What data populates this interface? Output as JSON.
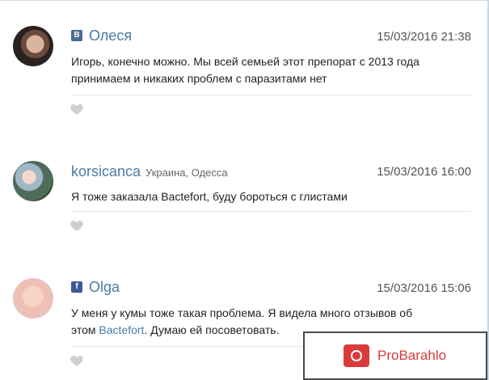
{
  "comments": [
    {
      "source": "vk-icon",
      "source_glyph": "B",
      "author": "Олеся",
      "location": "",
      "date": "15/03/2016 21:38",
      "text_line1": "Игорь, конечно можно. Мы всей семьей этот препорат с 2013 года",
      "text_line2": "принимаем и никаких проблем с паразитами нет"
    },
    {
      "source": "",
      "author": "korsicanca",
      "location": "Украина, Одесса",
      "date": "15/03/2016 16:00",
      "text_line1": "Я тоже заказала Bactefort, буду бороться с глистами"
    },
    {
      "source": "fb-icon",
      "source_glyph": "f",
      "author": "Olga",
      "location": "",
      "date": "15/03/2016 15:06",
      "text_line1": "У меня у кумы тоже такая проблема. Я видела много отзывов об",
      "text_line2_prefix": "этом ",
      "text_line2_link": "Bactefort",
      "text_line2_suffix": ". Думаю ей посоветовать."
    }
  ],
  "promo": {
    "label": "ProBarahlo"
  },
  "colors": {
    "link": "#4a7aa5",
    "promo": "#d93a3a"
  }
}
